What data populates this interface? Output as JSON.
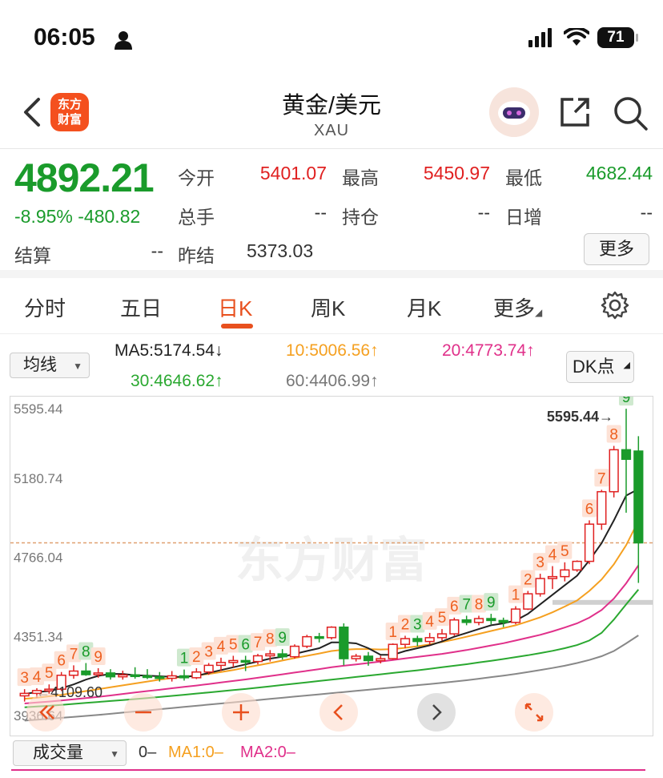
{
  "status_bar": {
    "time": "06:05",
    "battery": "71"
  },
  "header": {
    "title": "黄金/美元",
    "subtitle": "XAU",
    "logo_text": "东方\n财富"
  },
  "quote": {
    "price": "4892.21",
    "change_pct": "-8.95%",
    "change": "-480.82",
    "open_label": "今开",
    "open": "5401.07",
    "high_label": "最高",
    "high": "5450.97",
    "low_label": "最低",
    "low": "4682.44",
    "volume_label": "总手",
    "volume": "--",
    "position_label": "持仓",
    "position": "--",
    "daily_inc_label": "日增",
    "daily_inc": "--",
    "settle_label": "结算",
    "settle": "--",
    "prev_settle_label": "昨结",
    "prev_settle": "5373.03",
    "more_label": "更多"
  },
  "tabs": [
    "分时",
    "五日",
    "日K",
    "周K",
    "月K",
    "更多"
  ],
  "ma_bar": {
    "select_label": "均线",
    "ma5": "MA5:5174.54",
    "ma10": "10:5006.56",
    "ma20": "20:4773.74",
    "ma30": "30:4646.62",
    "ma60": "60:4406.99",
    "dk_label": "DK点",
    "colors": {
      "ma5": "#222222",
      "ma10": "#f5a020",
      "ma20": "#e0308a",
      "ma30": "#2aa830",
      "ma60": "#888888"
    }
  },
  "chart_data": {
    "type": "candlestick",
    "y_labels": [
      "5595.44",
      "5180.74",
      "4766.04",
      "4351.34",
      "3936.64"
    ],
    "ylim": [
      3936.64,
      5595.44
    ],
    "max_marker": "5595.44",
    "min_marker": "4109.60",
    "dashed_line": 4892.21,
    "candles": [
      {
        "o": 4090,
        "h": 4125,
        "l": 4060,
        "c": 4103,
        "n": "3"
      },
      {
        "o": 4103,
        "h": 4130,
        "l": 4080,
        "c": 4118,
        "n": "4"
      },
      {
        "o": 4118,
        "h": 4150,
        "l": 4100,
        "c": 4125,
        "n": "5"
      },
      {
        "o": 4125,
        "h": 4215,
        "l": 4115,
        "c": 4198,
        "n": "6"
      },
      {
        "o": 4198,
        "h": 4250,
        "l": 4180,
        "c": 4220,
        "n": "7"
      },
      {
        "o": 4220,
        "h": 4262,
        "l": 4195,
        "c": 4201,
        "n": "8"
      },
      {
        "o": 4201,
        "h": 4235,
        "l": 4185,
        "c": 4210,
        "n": "9"
      },
      {
        "o": 4210,
        "h": 4230,
        "l": 4175,
        "c": 4190,
        "n": ""
      },
      {
        "o": 4190,
        "h": 4222,
        "l": 4175,
        "c": 4200,
        "n": ""
      },
      {
        "o": 4200,
        "h": 4240,
        "l": 4180,
        "c": 4195,
        "n": ""
      },
      {
        "o": 4195,
        "h": 4230,
        "l": 4178,
        "c": 4190,
        "n": ""
      },
      {
        "o": 4190,
        "h": 4215,
        "l": 4165,
        "c": 4182,
        "n": ""
      },
      {
        "o": 4182,
        "h": 4220,
        "l": 4165,
        "c": 4195,
        "n": ""
      },
      {
        "o": 4195,
        "h": 4228,
        "l": 4170,
        "c": 4185,
        "n": "1"
      },
      {
        "o": 4185,
        "h": 4235,
        "l": 4178,
        "c": 4215,
        "n": "2"
      },
      {
        "o": 4215,
        "h": 4262,
        "l": 4200,
        "c": 4250,
        "n": "3"
      },
      {
        "o": 4250,
        "h": 4290,
        "l": 4220,
        "c": 4265,
        "n": "4"
      },
      {
        "o": 4265,
        "h": 4300,
        "l": 4240,
        "c": 4275,
        "n": "5"
      },
      {
        "o": 4275,
        "h": 4300,
        "l": 4220,
        "c": 4270,
        "n": "6"
      },
      {
        "o": 4270,
        "h": 4310,
        "l": 4255,
        "c": 4300,
        "n": "7"
      },
      {
        "o": 4300,
        "h": 4330,
        "l": 4270,
        "c": 4310,
        "n": "8"
      },
      {
        "o": 4310,
        "h": 4335,
        "l": 4280,
        "c": 4295,
        "n": "9"
      },
      {
        "o": 4295,
        "h": 4360,
        "l": 4285,
        "c": 4350,
        "n": ""
      },
      {
        "o": 4350,
        "h": 4410,
        "l": 4340,
        "c": 4400,
        "n": ""
      },
      {
        "o": 4400,
        "h": 4420,
        "l": 4370,
        "c": 4395,
        "n": ""
      },
      {
        "o": 4395,
        "h": 4455,
        "l": 4385,
        "c": 4450,
        "n": ""
      },
      {
        "o": 4450,
        "h": 4470,
        "l": 4250,
        "c": 4285,
        "n": ""
      },
      {
        "o": 4285,
        "h": 4310,
        "l": 4270,
        "c": 4298,
        "n": ""
      },
      {
        "o": 4298,
        "h": 4320,
        "l": 4248,
        "c": 4275,
        "n": ""
      },
      {
        "o": 4275,
        "h": 4300,
        "l": 4260,
        "c": 4285,
        "n": ""
      },
      {
        "o": 4285,
        "h": 4365,
        "l": 4280,
        "c": 4360,
        "n": "1"
      },
      {
        "o": 4360,
        "h": 4405,
        "l": 4340,
        "c": 4390,
        "n": "2"
      },
      {
        "o": 4390,
        "h": 4405,
        "l": 4350,
        "c": 4375,
        "n": "3"
      },
      {
        "o": 4375,
        "h": 4420,
        "l": 4358,
        "c": 4395,
        "n": "4"
      },
      {
        "o": 4395,
        "h": 4440,
        "l": 4380,
        "c": 4415,
        "n": "5"
      },
      {
        "o": 4415,
        "h": 4500,
        "l": 4405,
        "c": 4488,
        "n": "6"
      },
      {
        "o": 4488,
        "h": 4510,
        "l": 4460,
        "c": 4475,
        "n": "7"
      },
      {
        "o": 4475,
        "h": 4510,
        "l": 4460,
        "c": 4495,
        "n": "8"
      },
      {
        "o": 4495,
        "h": 4520,
        "l": 4465,
        "c": 4485,
        "n": "9"
      },
      {
        "o": 4485,
        "h": 4500,
        "l": 4450,
        "c": 4475,
        "n": ""
      },
      {
        "o": 4475,
        "h": 4560,
        "l": 4465,
        "c": 4545,
        "n": "1"
      },
      {
        "o": 4545,
        "h": 4640,
        "l": 4540,
        "c": 4625,
        "n": "2"
      },
      {
        "o": 4625,
        "h": 4730,
        "l": 4610,
        "c": 4705,
        "n": "3"
      },
      {
        "o": 4705,
        "h": 4770,
        "l": 4650,
        "c": 4715,
        "n": "4"
      },
      {
        "o": 4715,
        "h": 4790,
        "l": 4690,
        "c": 4750,
        "n": "5"
      },
      {
        "o": 4750,
        "h": 4800,
        "l": 4740,
        "c": 4795,
        "n": ""
      },
      {
        "o": 4795,
        "h": 5010,
        "l": 4780,
        "c": 4990,
        "n": "6"
      },
      {
        "o": 4990,
        "h": 5170,
        "l": 4960,
        "c": 5160,
        "n": "7"
      },
      {
        "o": 5160,
        "h": 5400,
        "l": 5130,
        "c": 5380,
        "n": "8"
      },
      {
        "o": 5380,
        "h": 5595,
        "l": 5050,
        "c": 5330,
        "n": "9"
      },
      {
        "o": 5373,
        "h": 5451,
        "l": 4682,
        "c": 4892,
        "n": ""
      }
    ],
    "ma5": [
      4100,
      4110,
      4115,
      4130,
      4150,
      4175,
      4195,
      4205,
      4205,
      4198,
      4196,
      4193,
      4190,
      4190,
      4195,
      4210,
      4225,
      4240,
      4255,
      4270,
      4285,
      4295,
      4310,
      4325,
      4340,
      4370,
      4370,
      4365,
      4340,
      4305,
      4305,
      4325,
      4340,
      4355,
      4375,
      4400,
      4420,
      4440,
      4460,
      4470,
      4485,
      4520,
      4570,
      4620,
      4670,
      4720,
      4800,
      4890,
      5010,
      5140,
      5174
    ],
    "ma10": [
      4075,
      4080,
      4088,
      4095,
      4105,
      4115,
      4125,
      4135,
      4145,
      4155,
      4165,
      4175,
      4183,
      4190,
      4197,
      4205,
      4215,
      4225,
      4238,
      4250,
      4262,
      4275,
      4288,
      4300,
      4312,
      4325,
      4332,
      4335,
      4335,
      4333,
      4335,
      4342,
      4350,
      4360,
      4372,
      4385,
      4400,
      4415,
      4430,
      4445,
      4460,
      4480,
      4502,
      4528,
      4558,
      4590,
      4640,
      4700,
      4780,
      4880,
      5007
    ],
    "ma20": [
      4050,
      4055,
      4060,
      4066,
      4072,
      4078,
      4085,
      4092,
      4100,
      4108,
      4115,
      4122,
      4130,
      4137,
      4144,
      4152,
      4160,
      4168,
      4176,
      4185,
      4194,
      4203,
      4212,
      4221,
      4230,
      4240,
      4248,
      4255,
      4262,
      4270,
      4278,
      4286,
      4294,
      4302,
      4310,
      4320,
      4330,
      4342,
      4354,
      4366,
      4380,
      4395,
      4410,
      4428,
      4448,
      4470,
      4500,
      4540,
      4600,
      4680,
      4774
    ],
    "ma30": [
      4030,
      4034,
      4038,
      4043,
      4048,
      4053,
      4058,
      4063,
      4068,
      4073,
      4078,
      4084,
      4090,
      4096,
      4102,
      4108,
      4114,
      4120,
      4126,
      4133,
      4140,
      4147,
      4154,
      4161,
      4168,
      4175,
      4182,
      4189,
      4196,
      4203,
      4210,
      4217,
      4224,
      4232,
      4240,
      4248,
      4256,
      4265,
      4274,
      4283,
      4293,
      4303,
      4314,
      4326,
      4340,
      4356,
      4380,
      4420,
      4490,
      4570,
      4647
    ],
    "ma60": [
      3960,
      3965,
      3970,
      3975,
      3980,
      3985,
      3990,
      3996,
      4002,
      4008,
      4014,
      4020,
      4026,
      4032,
      4038,
      4044,
      4050,
      4056,
      4062,
      4068,
      4074,
      4080,
      4086,
      4092,
      4098,
      4104,
      4110,
      4116,
      4122,
      4128,
      4134,
      4140,
      4146,
      4152,
      4158,
      4165,
      4172,
      4180,
      4188,
      4196,
      4205,
      4215,
      4225,
      4236,
      4248,
      4262,
      4278,
      4298,
      4325,
      4365,
      4407
    ]
  },
  "chart_controls": [
    "zoom-out-double",
    "minus",
    "plus",
    "left",
    "right",
    "fullscreen"
  ],
  "volume_bar": {
    "select_label": "成交量",
    "v0": "0–",
    "ma1": "MA1:0–",
    "ma2": "MA2:0–"
  },
  "watermark": "东方财富"
}
